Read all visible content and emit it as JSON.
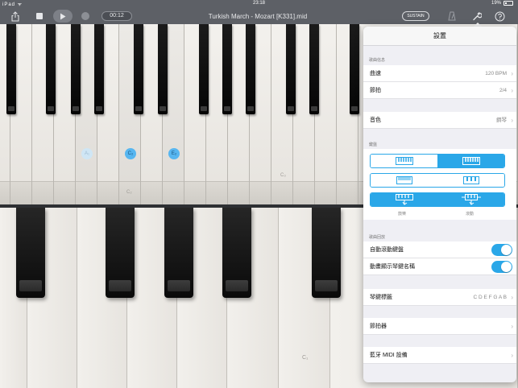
{
  "status_bar": {
    "left": "iPad ᯤ",
    "time": "23:18",
    "battery": "19%"
  },
  "toolbar": {
    "time": "00:12",
    "song_title": "Turkish March - Mozart [K331].mid",
    "sustain": "SUSTAIN"
  },
  "upper_keyboard": {
    "notes": {
      "a": "A₁",
      "c": "C₂",
      "e": "E₂"
    },
    "labels": {
      "c2": "C₂",
      "c3": "C₃"
    }
  },
  "lower_keyboard": {
    "c1": "C₁"
  },
  "settings": {
    "title": "設置",
    "song_info_header": "歌曲信息",
    "tempo": {
      "label": "曲速",
      "value": "120 BPM"
    },
    "beat": {
      "label": "節拍",
      "value": "2/4"
    },
    "sound": {
      "label": "音色",
      "value": "鋼琴"
    },
    "keyboard_header": "鍵盤",
    "mode_labels": {
      "left": "鼓樂",
      "right": "滾動"
    },
    "playback_header": "歌曲回放",
    "auto_scroll": {
      "label": "自動滾動鍵盤"
    },
    "animate_names": {
      "label": "動畫顯示琴鍵名稱"
    },
    "key_labels": {
      "label": "琴鍵標籤",
      "value": "C D E F G A B"
    },
    "metronome": {
      "label": "節拍器"
    },
    "bluetooth": {
      "label": "藍牙 MIDI 設備"
    }
  },
  "colors": {
    "accent": "#2aa7e8",
    "toolbar": "#5d6066",
    "note_active": "#57b6f0"
  }
}
